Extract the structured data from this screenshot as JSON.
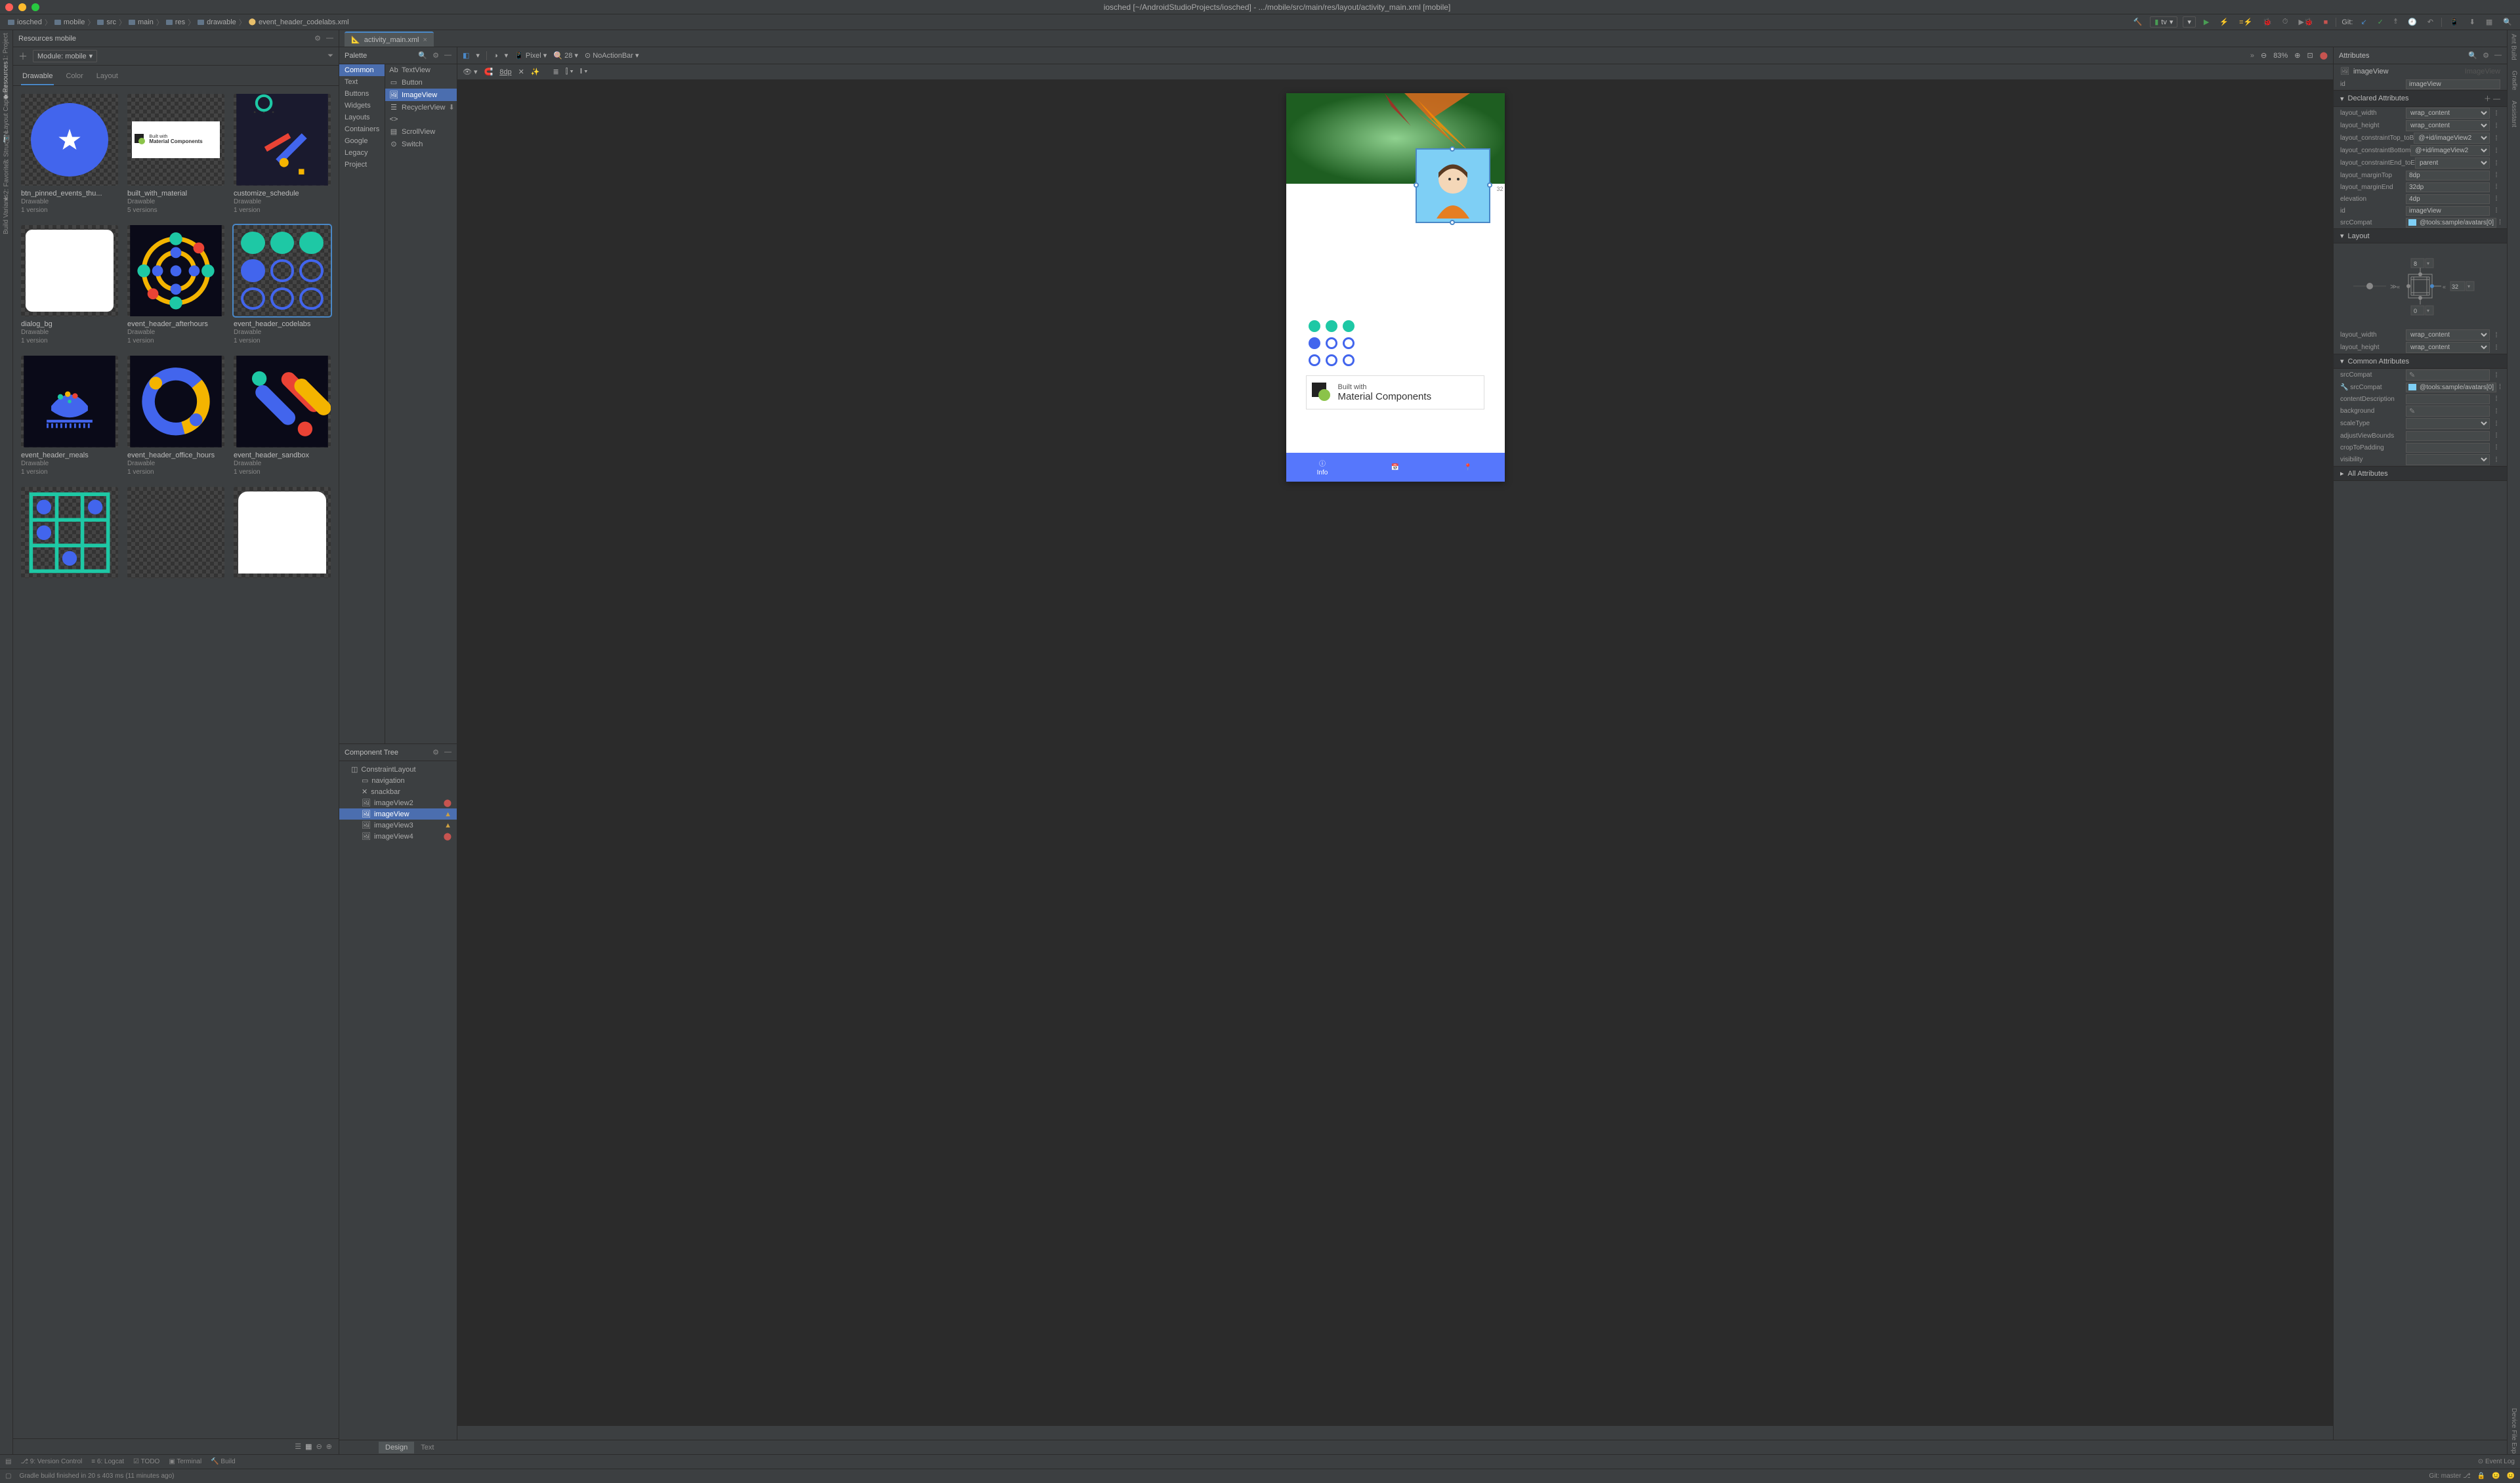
{
  "title": "iosched [~/AndroidStudioProjects/iosched] - .../mobile/src/main/res/layout/activity_main.xml [mobile]",
  "breadcrumb": [
    "iosched",
    "mobile",
    "src",
    "main",
    "res",
    "drawable",
    "event_header_codelabs.xml"
  ],
  "run_config": "tv",
  "git_label": "Git:",
  "resources": {
    "title": "Resources  mobile",
    "module": "Module: mobile",
    "tabs": [
      "Drawable",
      "Color",
      "Layout"
    ],
    "active_tab": 0,
    "items": [
      {
        "name": "btn_pinned_events_thu...",
        "versions": "1 version"
      },
      {
        "name": "built_with_material",
        "versions": "5 versions"
      },
      {
        "name": "customize_schedule",
        "versions": "1 version"
      },
      {
        "name": "dialog_bg",
        "versions": "1 version"
      },
      {
        "name": "event_header_afterhours",
        "versions": "1 version"
      },
      {
        "name": "event_header_codelabs",
        "versions": "1 version",
        "selected": true
      },
      {
        "name": "event_header_meals",
        "versions": "1 version"
      },
      {
        "name": "event_header_office_hours",
        "versions": "1 version"
      },
      {
        "name": "event_header_sandbox",
        "versions": "1 version"
      }
    ],
    "meta_label": "Drawable"
  },
  "editor_tab": "activity_main.xml",
  "palette": {
    "title": "Palette",
    "categories": [
      "Common",
      "Text",
      "Buttons",
      "Widgets",
      "Layouts",
      "Containers",
      "Google",
      "Legacy",
      "Project"
    ],
    "active_cat": 0,
    "widgets": [
      "TextView",
      "Button",
      "ImageView",
      "RecyclerView",
      "<fragment>",
      "ScrollView",
      "Switch"
    ],
    "active_widget": 2
  },
  "component_tree": {
    "title": "Component Tree",
    "root": "ConstraintLayout",
    "children": [
      {
        "name": "navigation",
        "warn": ""
      },
      {
        "name": "snackbar",
        "warn": ""
      },
      {
        "name": "imageView2",
        "warn": "red"
      },
      {
        "name": "imageView",
        "warn": "yellow",
        "selected": true
      },
      {
        "name": "imageView3",
        "warn": "yellow"
      },
      {
        "name": "imageView4",
        "warn": "red"
      }
    ]
  },
  "design_toolbar": {
    "device": "Pixel",
    "api": "28",
    "theme": "NoActionBar",
    "zoom": "83%",
    "margin": "8dp"
  },
  "preview": {
    "material_built": "Built with",
    "material_comp": "Material Components",
    "bottomnav": [
      "Info",
      "",
      ""
    ],
    "measure": "32"
  },
  "attributes": {
    "title": "Attributes",
    "element": "imageView",
    "unnamed": "ImageView",
    "id": "imageView",
    "sections": {
      "declared": "Declared Attributes",
      "layout": "Layout",
      "common": "Common Attributes",
      "all": "All Attributes"
    },
    "declared": [
      {
        "label": "layout_width",
        "value": "wrap_content",
        "dropdown": true
      },
      {
        "label": "layout_height",
        "value": "wrap_content",
        "dropdown": true
      },
      {
        "label": "layout_constraintTop_toB",
        "value": "@+id/imageView2",
        "dropdown": true
      },
      {
        "label": "layout_constraintBottom",
        "value": "@+id/imageView2",
        "dropdown": true
      },
      {
        "label": "layout_constraintEnd_toE",
        "value": "parent",
        "dropdown": true
      },
      {
        "label": "layout_marginTop",
        "value": "8dp"
      },
      {
        "label": "layout_marginEnd",
        "value": "32dp"
      },
      {
        "label": "elevation",
        "value": "4dp"
      },
      {
        "label": "id",
        "value": "imageView"
      },
      {
        "label": "srcCompat",
        "value": "@tools:sample/avatars[0]",
        "icon": true
      }
    ],
    "layout_constraint": {
      "top": "8",
      "right": "32",
      "bottom": "0"
    },
    "layout_wh": [
      {
        "label": "layout_width",
        "value": "wrap_content"
      },
      {
        "label": "layout_height",
        "value": "wrap_content"
      }
    ],
    "common": [
      {
        "label": "srcCompat",
        "value": "",
        "pencil": true
      },
      {
        "label": "srcCompat",
        "value": "@tools:sample/avatars[0]",
        "icon": true,
        "tool": true
      },
      {
        "label": "contentDescription",
        "value": ""
      },
      {
        "label": "background",
        "value": "",
        "pencil": true
      },
      {
        "label": "scaleType",
        "value": "",
        "dropdown": true
      },
      {
        "label": "adjustViewBounds",
        "value": ""
      },
      {
        "label": "cropToPadding",
        "value": ""
      },
      {
        "label": "visibility",
        "value": "",
        "dropdown": true
      }
    ]
  },
  "design_footer": [
    "Design",
    "Text"
  ],
  "bottom_tabs": [
    "9: Version Control",
    "6: Logcat",
    "TODO",
    "Terminal",
    "Build"
  ],
  "status": {
    "msg": "Gradle build finished in 20 s 403 ms (11 minutes ago)",
    "event_log": "Event Log",
    "git_branch": "Git: master"
  }
}
